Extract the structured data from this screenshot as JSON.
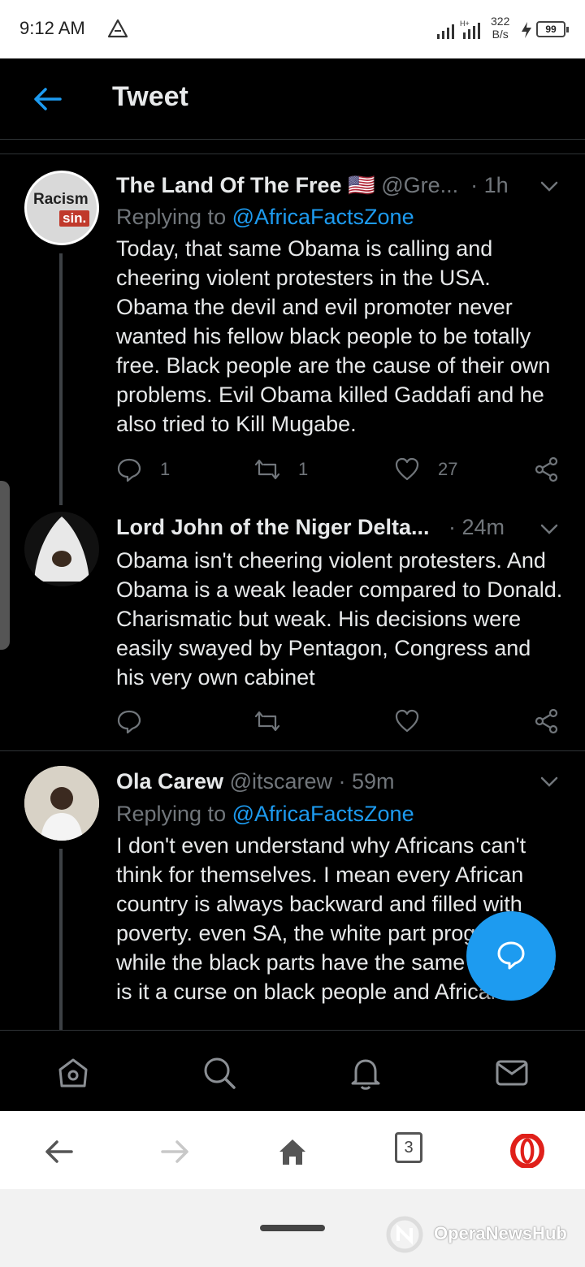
{
  "status_bar": {
    "time": "9:12 AM",
    "speed_value": "322",
    "speed_unit": "B/s",
    "battery": "99"
  },
  "header": {
    "title": "Tweet"
  },
  "tweets": [
    {
      "name": "The Land Of The Free",
      "flag": "🇺🇸",
      "handle": "@Gre...",
      "time": "· 1h",
      "reply_prefix": "Replying to",
      "reply_mention": "@AfricaFactsZone",
      "avatar_line1": "Racism",
      "avatar_line2": "sin.",
      "text": "Today, that same Obama is calling and cheering violent protesters in the USA. Obama the devil and evil promoter never wanted his fellow black people to be totally free. Black people are the cause of their own problems. Evil Obama killed Gaddafi and he also tried to Kill Mugabe.",
      "replies": "1",
      "retweets": "1",
      "likes": "27"
    },
    {
      "name": "Lord John of the Niger Delta...",
      "time": "· 24m",
      "text": "Obama isn't cheering violent protesters. And Obama is a weak leader compared to Donald. Charismatic but weak. His decisions were easily swayed by Pentagon, Congress and his very own cabinet"
    },
    {
      "name": "Ola Carew",
      "handle": "@itscarew",
      "time": "· 59m",
      "reply_prefix": "Replying to",
      "reply_mention": "@AfricaFactsZone",
      "text": "I don't even understand why Africans can't think for themselves. I mean every African country is always backward and filled with poverty. even SA, the white part progress while the black parts have the same problem. is it a curse on black people and Africans?"
    }
  ],
  "browser": {
    "tab_count": "3"
  },
  "watermark": {
    "text": "OperaNewsHub"
  },
  "colors": {
    "accent": "#1d9bf0",
    "muted": "#71767b",
    "background": "#000000",
    "opera_red": "#e0201a"
  }
}
